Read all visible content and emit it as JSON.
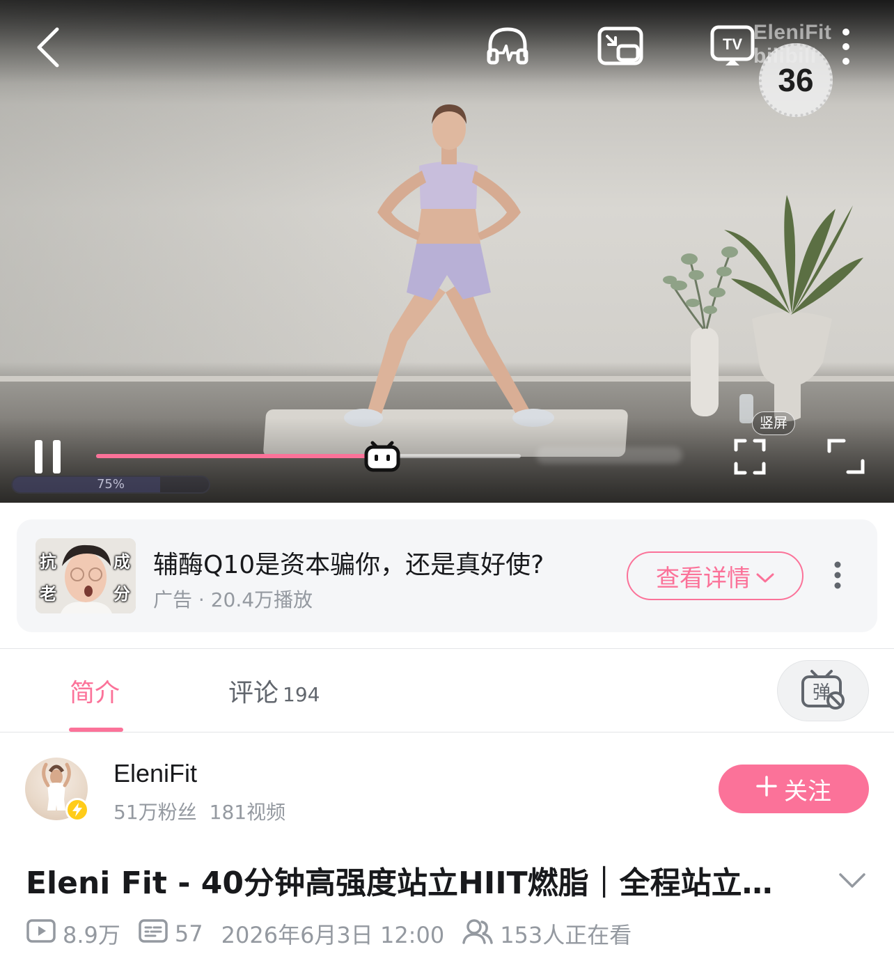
{
  "player": {
    "watermark": "EleniFit bilibili",
    "timer": "36",
    "portrait_label": "竖屏",
    "volume_label": "75%",
    "volume_level": 0.75,
    "progress_fraction": 0.67,
    "accent_color": "#fb7299",
    "icons": [
      "back-icon",
      "headphones-icon",
      "picture-in-picture-icon",
      "tv-cast-icon",
      "more-vertical-icon",
      "pause-icon",
      "fullscreen-icon",
      "rotate-screen-icon"
    ]
  },
  "ad": {
    "thumb_chars": [
      "抗",
      "成",
      "老",
      "分"
    ],
    "title": "辅酶Q10是资本骗你，还是真好使?",
    "meta": "广告 · 20.4万播放",
    "button_label": "查看详情"
  },
  "tabs": {
    "intro": "简介",
    "comments": "评论",
    "comments_count": "194"
  },
  "uploader": {
    "name": "EleniFit",
    "fans": "51万粉丝",
    "videos": "181视频",
    "follow_label": "关注"
  },
  "video": {
    "title": "Eleni Fit -  40分钟高强度站立HIIT燃脂｜全程站立…",
    "views": "8.9万",
    "danmaku_count": "57",
    "publish_time": "2026年6月3日 12:00",
    "watching": "153人正在看"
  }
}
